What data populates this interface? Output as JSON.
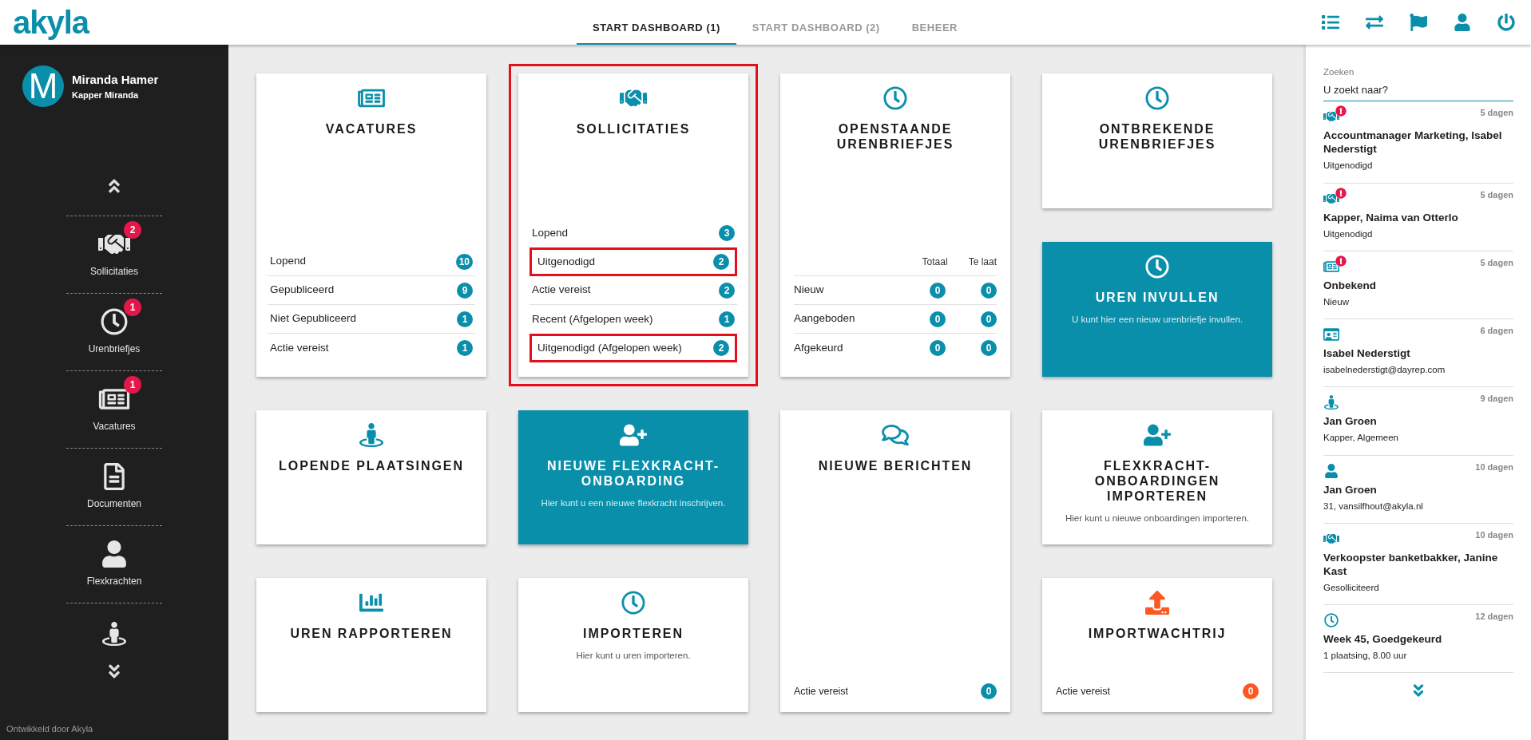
{
  "header": {
    "logo": "akyla",
    "tabs": [
      {
        "label": "START DASHBOARD (1)",
        "selected": true
      },
      {
        "label": "START DASHBOARD (2)",
        "selected": false
      },
      {
        "label": "BEHEER",
        "selected": false
      }
    ]
  },
  "sidebar": {
    "user": {
      "initial": "M",
      "name": "Miranda Hamer",
      "role": "Kapper Miranda"
    },
    "items": [
      {
        "label": "Sollicitaties",
        "badge": "2"
      },
      {
        "label": "Urenbriefjes",
        "badge": "1"
      },
      {
        "label": "Vacatures",
        "badge": "1"
      },
      {
        "label": "Documenten"
      },
      {
        "label": "Flexkrachten"
      }
    ],
    "footer": "Ontwikkeld door Akyla"
  },
  "cards": [
    {
      "kind": "list",
      "title": "VACATURES",
      "highlighted": false,
      "rows": [
        {
          "label": "Lopend",
          "count": "10",
          "highlighted": false
        },
        {
          "label": "Gepubliceerd",
          "count": "9",
          "highlighted": false
        },
        {
          "label": "Niet Gepubliceerd",
          "count": "1",
          "highlighted": false
        },
        {
          "label": "Actie vereist",
          "count": "1",
          "highlighted": false
        }
      ]
    },
    {
      "kind": "list",
      "title": "SOLLICITATIES",
      "highlighted": true,
      "rows": [
        {
          "label": "Lopend",
          "count": "3",
          "highlighted": false
        },
        {
          "label": "Uitgenodigd",
          "count": "2",
          "highlighted": true
        },
        {
          "label": "Actie vereist",
          "count": "2",
          "highlighted": false
        },
        {
          "label": "Recent (Afgelopen week)",
          "count": "1",
          "highlighted": false
        },
        {
          "label": "Uitgenodigd (Afgelopen week)",
          "count": "2",
          "highlighted": true
        }
      ]
    },
    {
      "kind": "table",
      "title": "OPENSTAANDE URENBRIEFJES",
      "columns": [
        "Totaal",
        "Te laat"
      ],
      "rows": [
        {
          "label": "Nieuw",
          "values": [
            "0",
            "0"
          ]
        },
        {
          "label": "Aangeboden",
          "values": [
            "0",
            "0"
          ]
        },
        {
          "label": "Afgekeurd",
          "values": [
            "0",
            "0"
          ]
        }
      ]
    },
    {
      "kind": "plain",
      "title": "ONTBREKENDE URENBRIEFJES"
    },
    {
      "kind": "action",
      "title": "UREN INVULLEN",
      "description": "U kunt hier een nieuw urenbriefje invullen."
    },
    {
      "kind": "plain",
      "title": "LOPENDE PLAATSINGEN"
    },
    {
      "kind": "action",
      "title": "NIEUWE FLEXKRACHT-ONBOARDING",
      "description": "Hier kunt u een nieuwe flexkracht inschrijven."
    },
    {
      "kind": "plain",
      "title": "NIEUWE BERICHTEN",
      "footer": {
        "label": "Actie vereist",
        "count": "0",
        "color": "#0a8fab"
      }
    },
    {
      "kind": "plain",
      "title": "FLEXKRACHT-ONBOARDINGEN IMPORTEREN",
      "description": "Hier kunt u nieuwe onboardingen importeren."
    },
    {
      "kind": "plain",
      "title": "UREN RAPPORTEREN"
    },
    {
      "kind": "plain",
      "title": "IMPORTEREN",
      "description": "Hier kunt u uren importeren."
    },
    {
      "kind": "plain",
      "title": "IMPORTWACHTRIJ",
      "footer": {
        "label": "Actie vereist",
        "count": "0",
        "color": "#ff5722"
      }
    }
  ],
  "feed": {
    "label": "Zoeken",
    "placeholder": "U zoekt naar?",
    "items": [
      {
        "age": "5 dagen",
        "title": "Accountmanager Marketing, Isabel Nederstigt",
        "subtitle": "Uitgenodigd",
        "alert": true
      },
      {
        "age": "5 dagen",
        "title": "Kapper, Naima van Otterlo",
        "subtitle": "Uitgenodigd",
        "alert": true
      },
      {
        "age": "5 dagen",
        "title": "Onbekend",
        "subtitle": "Nieuw",
        "alert": true
      },
      {
        "age": "6 dagen",
        "title": "Isabel Nederstigt",
        "subtitle": "isabelnederstigt@dayrep.com",
        "alert": false
      },
      {
        "age": "9 dagen",
        "title": "Jan Groen",
        "subtitle": "Kapper, Algemeen",
        "alert": false
      },
      {
        "age": "10 dagen",
        "title": "Jan Groen",
        "subtitle": "31, vansilfhout@akyla.nl",
        "alert": false
      },
      {
        "age": "10 dagen",
        "title": "Verkoopster banketbakker, Janine Kast",
        "subtitle": "Gesolliciteerd",
        "alert": false
      },
      {
        "age": "12 dagen",
        "title": "Week 45, Goedgekeurd",
        "subtitle": "1 plaatsing, 8.00 uur",
        "alert": false
      }
    ]
  }
}
